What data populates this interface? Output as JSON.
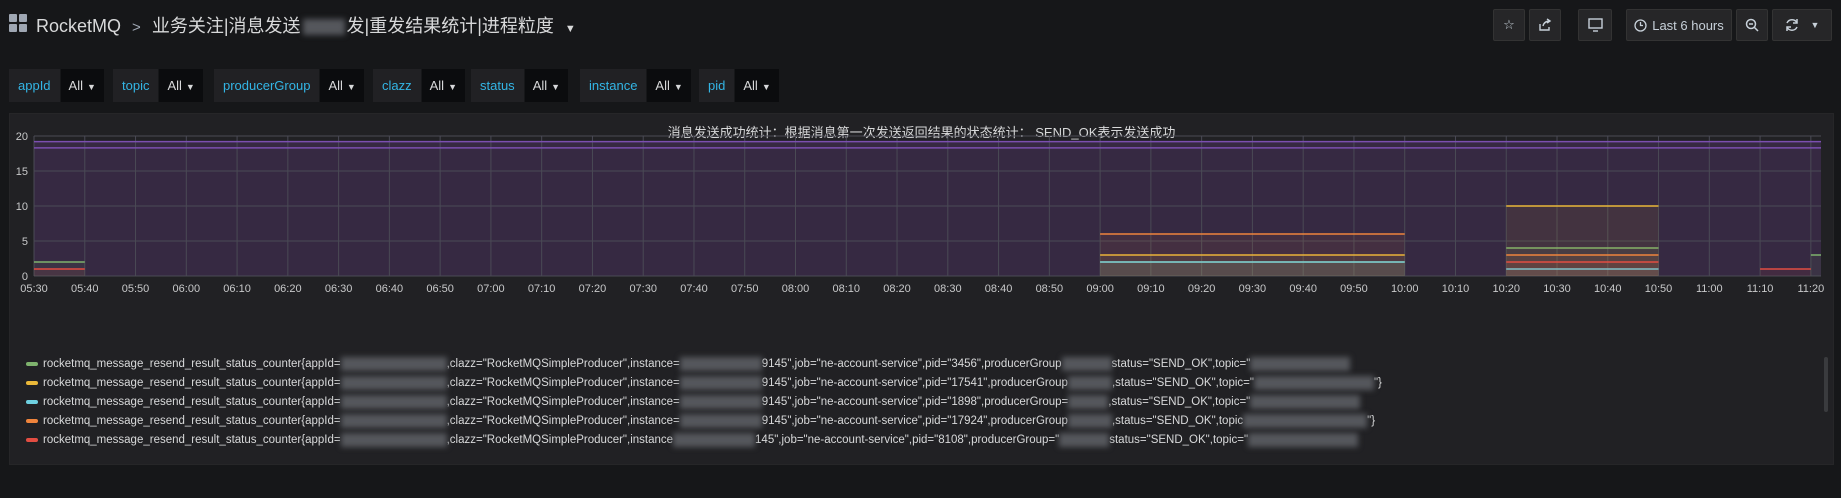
{
  "header": {
    "app_name": "RocketMQ",
    "breadcrumb_sep": ">",
    "title_part1": "业务关注",
    "title_part2": "消息发送",
    "title_part3": "发",
    "title_part4": "重发结果统计",
    "title_part5": "进程粒度",
    "pipe": "|",
    "time_range": "Last 6 hours"
  },
  "toolbar": {
    "star_icon": "star-icon",
    "share_icon": "share-icon",
    "tv_icon": "tv-icon",
    "clock_icon": "clock-icon",
    "zoom_icon": "zoom-out-icon",
    "refresh_icon": "refresh-icon"
  },
  "variables": [
    {
      "label": "appId",
      "value": "All"
    },
    {
      "label": "topic",
      "value": "All"
    },
    {
      "label": "producerGroup",
      "value": "All"
    },
    {
      "label": "clazz",
      "value": "All"
    },
    {
      "label": "status",
      "value": "All"
    },
    {
      "label": "instance",
      "value": "All"
    },
    {
      "label": "pid",
      "value": "All"
    }
  ],
  "panel": {
    "title": "消息发送成功统计：根据消息第一次发送返回结果的状态统计： SEND_OK表示发送成功"
  },
  "chart_data": {
    "type": "line",
    "title": "消息发送成功统计：根据消息第一次发送返回结果的状态统计： SEND_OK表示发送成功",
    "ylim": [
      0,
      20
    ],
    "y_ticks": [
      "0",
      "5",
      "10",
      "15",
      "20"
    ],
    "x_ticks": [
      "05:30",
      "05:40",
      "05:50",
      "06:00",
      "06:10",
      "06:20",
      "06:30",
      "06:40",
      "06:50",
      "07:00",
      "07:10",
      "07:20",
      "07:30",
      "07:40",
      "07:50",
      "08:00",
      "08:10",
      "08:20",
      "08:30",
      "08:40",
      "08:50",
      "09:00",
      "09:10",
      "09:20",
      "09:30",
      "09:40",
      "09:50",
      "10:00",
      "10:10",
      "10:20",
      "10:30",
      "10:40",
      "10:50",
      "11:00",
      "11:10",
      "11:20"
    ],
    "grid": true,
    "legend_position": "bottom",
    "series": [
      {
        "color": "#7eb26d",
        "segments": [
          {
            "x0": "05:30",
            "x1": "05:40",
            "y": 2
          },
          {
            "x0": "09:00",
            "x1": "10:00",
            "y": 2
          },
          {
            "x0": "10:20",
            "x1": "10:50",
            "y": 4
          },
          {
            "x0": "11:20",
            "x1": "11:22",
            "y": 3
          }
        ]
      },
      {
        "color": "#eab839",
        "segments": [
          {
            "x0": "09:00",
            "x1": "10:00",
            "y": 3
          },
          {
            "x0": "10:20",
            "x1": "10:50",
            "y": 10
          }
        ]
      },
      {
        "color": "#6ed0e0",
        "segments": [
          {
            "x0": "09:00",
            "x1": "10:00",
            "y": 2
          },
          {
            "x0": "10:20",
            "x1": "10:50",
            "y": 1
          }
        ]
      },
      {
        "color": "#ef843c",
        "segments": [
          {
            "x0": "09:00",
            "x1": "10:00",
            "y": 6
          },
          {
            "x0": "10:20",
            "x1": "10:50",
            "y": 3
          }
        ]
      },
      {
        "color": "#e24d42",
        "segments": [
          {
            "x0": "05:30",
            "x1": "05:40",
            "y": 1
          },
          {
            "x0": "10:20",
            "x1": "10:50",
            "y": 2
          },
          {
            "x0": "11:10",
            "x1": "11:20",
            "y": 1
          }
        ]
      },
      {
        "color": "#7b4fb0",
        "segments": [
          {
            "x0": "05:30",
            "x1": "11:22",
            "y": 18.3
          },
          {
            "x0": "05:30",
            "x1": "11:22",
            "y": 19.2
          }
        ]
      }
    ]
  },
  "legend": [
    {
      "color": "#7eb26d",
      "text_a": "rocketmq_message_resend_result_status_counter{appId=",
      "text_b": ",clazz=\"RocketMQSimpleProducer\",instance=",
      "text_c": "9145\",job=\"ne-account-service\",pid=\"3456\",producerGroup",
      "text_d": "status=\"SEND_OK\",topic=\""
    },
    {
      "color": "#eab839",
      "text_a": "rocketmq_message_resend_result_status_counter{appId=",
      "text_b": ",clazz=\"RocketMQSimpleProducer\",instance=",
      "text_c": "9145\",job=\"ne-account-service\",pid=\"17541\",producerGroup",
      "text_d": ",status=\"SEND_OK\",topic=\"",
      "text_e": "\"}"
    },
    {
      "color": "#6ed0e0",
      "text_a": "rocketmq_message_resend_result_status_counter{appId=",
      "text_b": ",clazz=\"RocketMQSimpleProducer\",instance=",
      "text_c": "9145\",job=\"ne-account-service\",pid=\"1898\",producerGroup=",
      "text_d": ",status=\"SEND_OK\",topic=\""
    },
    {
      "color": "#ef843c",
      "text_a": "rocketmq_message_resend_result_status_counter{appId=",
      "text_b": ",clazz=\"RocketMQSimpleProducer\",instance=",
      "text_c": "9145\",job=\"ne-account-service\",pid=\"17924\",producerGroup",
      "text_d": ",status=\"SEND_OK\",topic",
      "text_e": "\"}"
    },
    {
      "color": "#e24d42",
      "text_a": "rocketmq_message_resend_result_status_counter{appId=",
      "text_b": ",clazz=\"RocketMQSimpleProducer\",instance",
      "text_c": "145\",job=\"ne-account-service\",pid=\"8108\",producerGroup=\"",
      "text_d": "status=\"SEND_OK\",topic=\""
    }
  ]
}
